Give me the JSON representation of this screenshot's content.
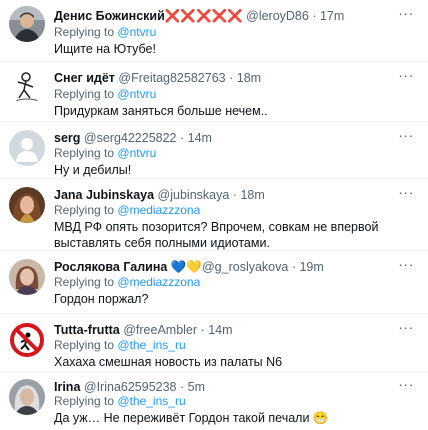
{
  "tweets": [
    {
      "name": "Денис Божинский",
      "decor": "❌❌❌❌❌",
      "handle": "@leroyD86",
      "sep": "·",
      "time": "17m",
      "reply_prefix": "Replying to",
      "reply_to": "@ntvru",
      "text": "Ищите на Ютубе!",
      "avatar_icon": "man-portrait-avatar"
    },
    {
      "name": "Снег идёт",
      "handle": "@Freitag82582763",
      "sep": "·",
      "time": "18m",
      "reply_prefix": "Replying to",
      "reply_to": "@ntvru",
      "text": "Придуркам заняться больше нечем..",
      "avatar_icon": "sketch-figure-avatar"
    },
    {
      "name": "serg",
      "handle": "@serg42225822",
      "sep": "·",
      "time": "14m",
      "reply_prefix": "Replying to",
      "reply_to": "@ntvru",
      "text": "Ну и дебилы!",
      "avatar_icon": "default-person-avatar"
    },
    {
      "name": "Jana Jubinskaya",
      "handle": "@jubinskaya",
      "sep": "·",
      "time": "18m",
      "reply_prefix": "Replying to",
      "reply_to": "@mediazzzona",
      "text": "МВД РФ опять позорится? Впрочем, совкам не впервой выставлять себя полными идиотами.",
      "avatar_icon": "woman-portrait-avatar"
    },
    {
      "name": "Рослякова Галина",
      "decor": "💙💛",
      "handle": "@g_roslyakova",
      "sep": "·",
      "time": "19m",
      "reply_prefix": "Replying to",
      "reply_to": "@mediazzzona",
      "text": "Гордон поржал?",
      "avatar_icon": "woman-photo-avatar"
    },
    {
      "name": "Tutta-frutta",
      "handle": "@freeAmbler",
      "sep": "·",
      "time": "14m",
      "reply_prefix": "Replying to",
      "reply_to": "@the_ins_ru",
      "text": "Хахаха смешная новость из палаты N6",
      "avatar_icon": "prohibition-sign-avatar"
    },
    {
      "name": "Irina",
      "handle": "@Irina62595238",
      "sep": "·",
      "time": "5m",
      "reply_prefix": "Replying to",
      "reply_to": "@the_ins_ru",
      "text": "Да уж… Не переживёт Гордон такой печали 😁",
      "avatar_icon": "woman-grey-photo-avatar"
    }
  ],
  "colors": {
    "accent": "#1d9bf0",
    "secondary_text": "#536471",
    "primary_text": "#0f1419",
    "divider": "#eff3f4"
  }
}
